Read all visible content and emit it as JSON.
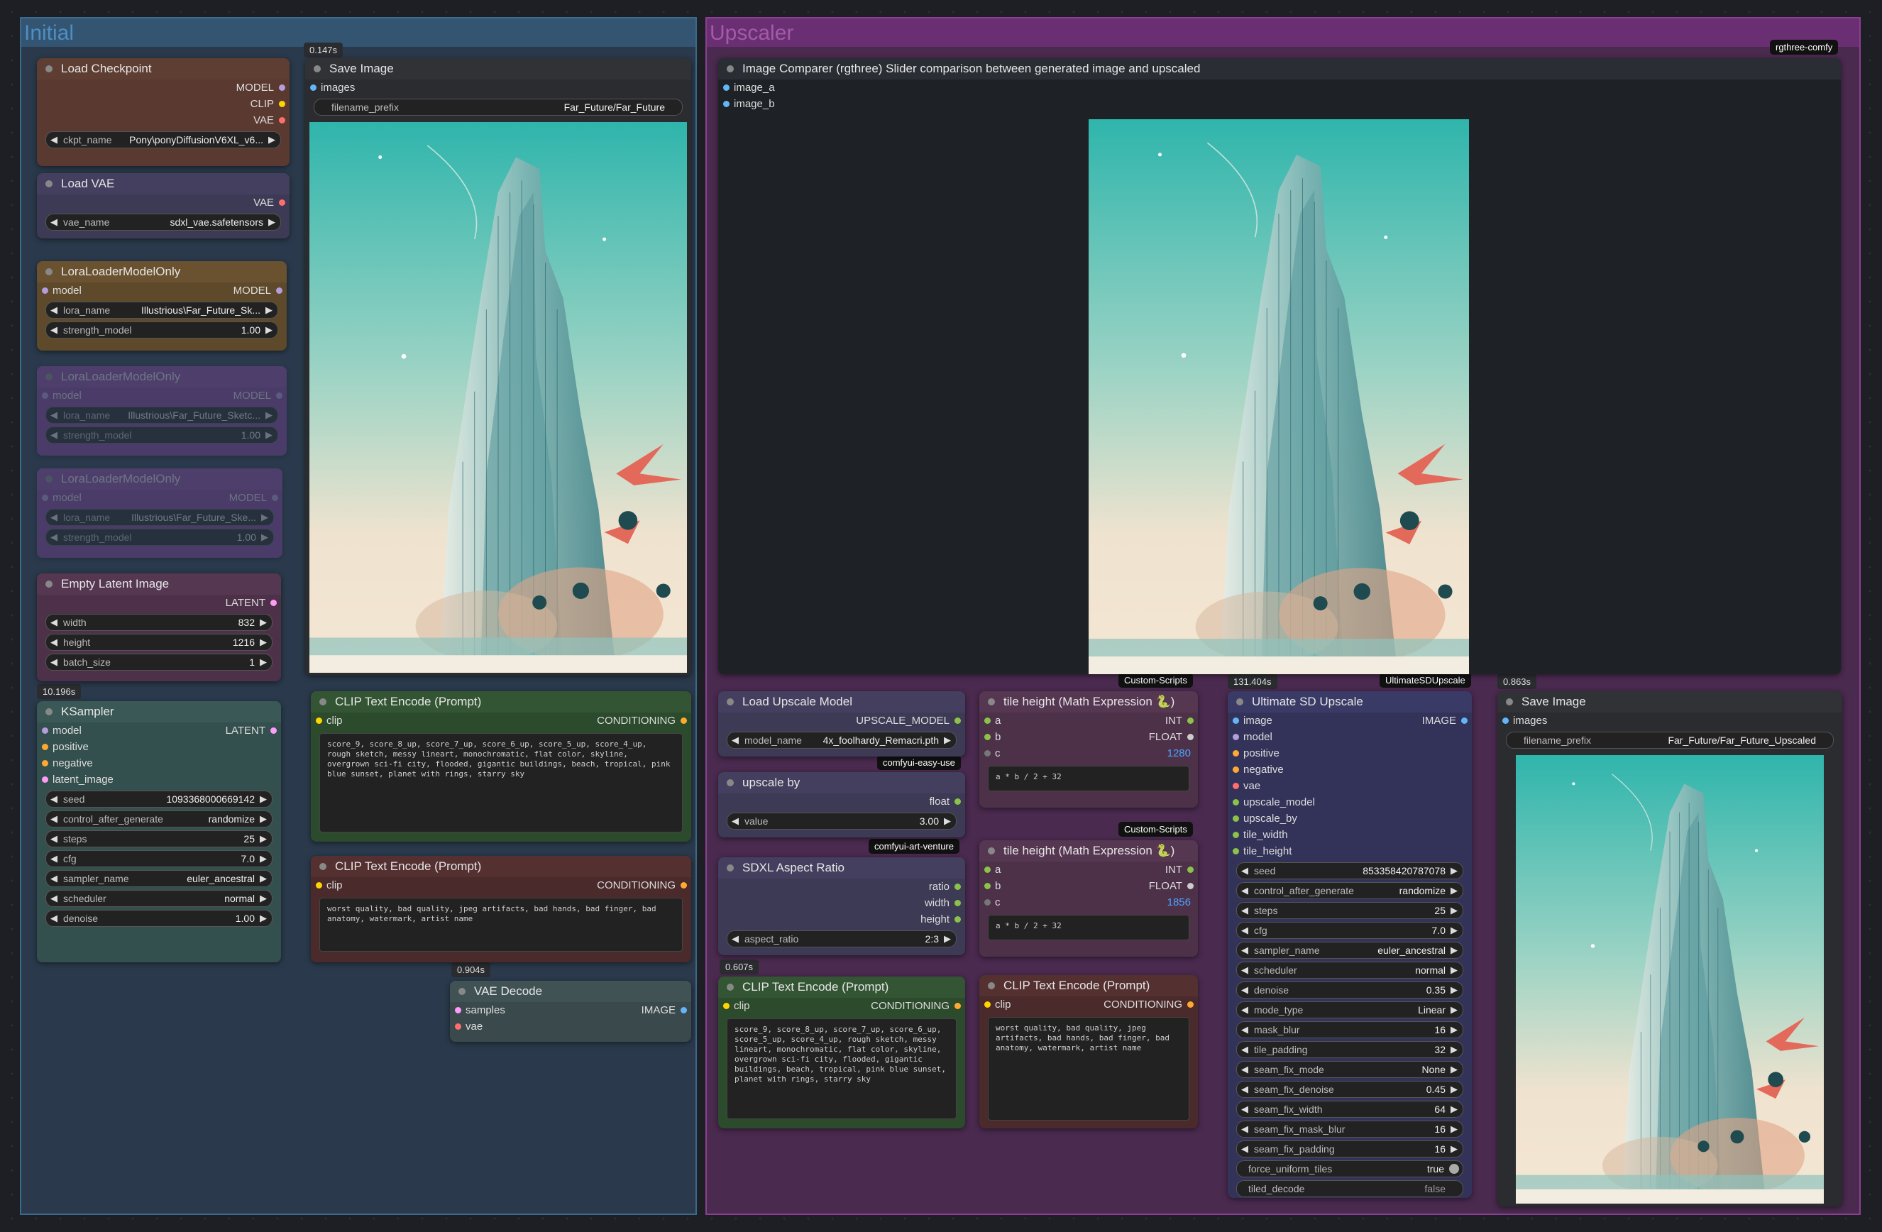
{
  "groups": {
    "initial": "Initial",
    "upscaler": "Upscaler"
  },
  "badges": {
    "save_image_time": "0.147s",
    "ksampler_time": "10.196s",
    "vae_decode_time": "0.904s",
    "clip_time": "0.607s",
    "upscale_time": "131.404s",
    "save_upscaled_time": "0.863s"
  },
  "tags": {
    "rgthree": "rgthree-comfy",
    "custom_scripts_1": "Custom-Scripts",
    "custom_scripts_2": "Custom-Scripts",
    "ultimate": "UltimateSDUpscale",
    "easy_use": "comfyui-easy-use",
    "art_venture": "comfyui-art-venture"
  },
  "load_checkpoint": {
    "title": "Load Checkpoint",
    "out_model": "MODEL",
    "out_clip": "CLIP",
    "out_vae": "VAE",
    "ckpt_label": "ckpt_name",
    "ckpt_value": "Pony\\ponyDiffusionV6XL_v6..."
  },
  "load_vae": {
    "title": "Load VAE",
    "out_vae": "VAE",
    "vae_label": "vae_name",
    "vae_value": "sdxl_vae.safetensors"
  },
  "lora1": {
    "title": "LoraLoaderModelOnly",
    "in_model": "model",
    "out_model": "MODEL",
    "lora_label": "lora_name",
    "lora_value": "Illustrious\\Far_Future_Sk...",
    "strength_label": "strength_model",
    "strength_value": "1.00"
  },
  "lora2": {
    "title": "LoraLoaderModelOnly",
    "in_model": "model",
    "out_model": "MODEL",
    "lora_label": "lora_name",
    "lora_value": "Illustrious\\Far_Future_Sketc...",
    "strength_label": "strength_model",
    "strength_value": "1.00"
  },
  "lora3": {
    "title": "LoraLoaderModelOnly",
    "in_model": "model",
    "out_model": "MODEL",
    "lora_label": "lora_name",
    "lora_value": "Illustrious\\Far_Future_Ske...",
    "strength_label": "strength_model",
    "strength_value": "1.00"
  },
  "empty_latent": {
    "title": "Empty Latent Image",
    "out_latent": "LATENT",
    "width_label": "width",
    "width_value": "832",
    "height_label": "height",
    "height_value": "1216",
    "batch_label": "batch_size",
    "batch_value": "1"
  },
  "ksampler": {
    "title": "KSampler",
    "in_model": "model",
    "in_positive": "positive",
    "in_negative": "negative",
    "in_latent": "latent_image",
    "out_latent": "LATENT",
    "widgets": [
      [
        "seed",
        "1093368000669142"
      ],
      [
        "control_after_generate",
        "randomize"
      ],
      [
        "steps",
        "25"
      ],
      [
        "cfg",
        "7.0"
      ],
      [
        "sampler_name",
        "euler_ancestral"
      ],
      [
        "scheduler",
        "normal"
      ],
      [
        "denoise",
        "1.00"
      ]
    ]
  },
  "save_image": {
    "title": "Save Image",
    "in_images": "images",
    "prefix_label": "filename_prefix",
    "prefix_value": "Far_Future/Far_Future"
  },
  "clip_pos": {
    "title": "CLIP Text Encode (Prompt)",
    "in_clip": "clip",
    "out": "CONDITIONING",
    "text": "score_9, score_8_up, score_7_up, score_6_up, score_5_up, score_4_up, rough sketch, messy lineart, monochromatic, flat color, skyline, overgrown sci-fi city, flooded, gigantic buildings, beach, tropical, pink blue sunset, planet with rings, starry sky"
  },
  "clip_neg": {
    "title": "CLIP Text Encode (Prompt)",
    "in_clip": "clip",
    "out": "CONDITIONING",
    "text": "worst quality, bad quality, jpeg artifacts, bad hands, bad finger, bad anatomy, watermark, artist name"
  },
  "vae_decode": {
    "title": "VAE Decode",
    "in_samples": "samples",
    "in_vae": "vae",
    "out_image": "IMAGE"
  },
  "image_comparer": {
    "title": "Image Comparer (rgthree)  Slider comparison between generated image and upscaled",
    "in_a": "image_a",
    "in_b": "image_b"
  },
  "load_upscale_model": {
    "title": "Load Upscale Model",
    "out": "UPSCALE_MODEL",
    "label": "model_name",
    "value": "4x_foolhardy_Remacri.pth"
  },
  "upscale_by": {
    "title": "upscale by",
    "out": "float",
    "label": "value",
    "value": "3.00"
  },
  "sdxl_aspect": {
    "title": "SDXL Aspect Ratio",
    "out_ratio": "ratio",
    "out_width": "width",
    "out_height": "height",
    "label": "aspect_ratio",
    "value": "2:3"
  },
  "math1": {
    "title": "tile height (Math Expression 🐍)",
    "in_a": "a",
    "in_b": "b",
    "in_c": "c",
    "out_int": "INT",
    "out_float": "FLOAT",
    "result": "1280",
    "expr": "a * b / 2 + 32"
  },
  "math2": {
    "title": "tile height (Math Expression 🐍)",
    "in_a": "a",
    "in_b": "b",
    "in_c": "c",
    "out_int": "INT",
    "out_float": "FLOAT",
    "result": "1856",
    "expr": "a * b / 2 + 32"
  },
  "clip_pos2": {
    "title": "CLIP Text Encode (Prompt)",
    "in_clip": "clip",
    "out": "CONDITIONING",
    "text": "score_9, score_8_up, score_7_up, score_6_up, score_5_up, score_4_up, rough sketch, messy lineart, monochromatic, flat color, skyline, overgrown sci-fi city, flooded, gigantic buildings, beach, tropical, pink blue sunset, planet with rings, starry sky"
  },
  "clip_neg2": {
    "title": "CLIP Text Encode (Prompt)",
    "in_clip": "clip",
    "out": "CONDITIONING",
    "text": "worst quality, bad quality, jpeg artifacts, bad hands, bad finger, bad anatomy, watermark, artist name"
  },
  "usd": {
    "title": "Ultimate SD Upscale",
    "inputs": [
      "image",
      "model",
      "positive",
      "negative",
      "vae",
      "upscale_model",
      "upscale_by",
      "tile_width",
      "tile_height"
    ],
    "out_image": "IMAGE",
    "widgets": [
      [
        "seed",
        "853358420787078"
      ],
      [
        "control_after_generate",
        "randomize"
      ],
      [
        "steps",
        "25"
      ],
      [
        "cfg",
        "7.0"
      ],
      [
        "sampler_name",
        "euler_ancestral"
      ],
      [
        "scheduler",
        "normal"
      ],
      [
        "denoise",
        "0.35"
      ],
      [
        "mode_type",
        "Linear"
      ],
      [
        "mask_blur",
        "16"
      ],
      [
        "tile_padding",
        "32"
      ],
      [
        "seam_fix_mode",
        "None"
      ],
      [
        "seam_fix_denoise",
        "0.45"
      ],
      [
        "seam_fix_width",
        "64"
      ],
      [
        "seam_fix_mask_blur",
        "16"
      ],
      [
        "seam_fix_padding",
        "16"
      ]
    ],
    "force_label": "force_uniform_tiles",
    "force_value": "true",
    "tiled_label": "tiled_decode",
    "tiled_value": "false"
  },
  "save_upscaled": {
    "title": "Save Image",
    "in_images": "images",
    "prefix_label": "filename_prefix",
    "prefix_value": "Far_Future/Far_Future_Upscaled"
  }
}
